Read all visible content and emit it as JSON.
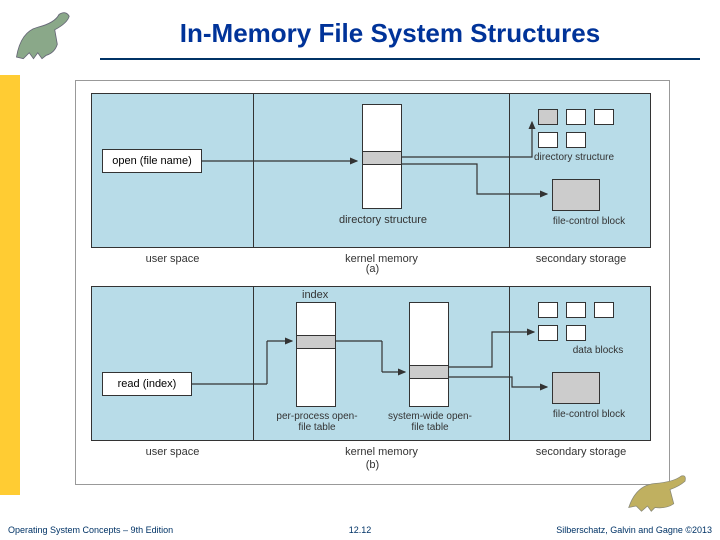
{
  "title": "In-Memory File System Structures",
  "footer": {
    "left": "Operating System Concepts – 9th Edition",
    "center": "12.12",
    "right": "Silberschatz, Galvin and Gagne ©2013"
  },
  "diagram": {
    "panelA": {
      "user_op": "open (file name)",
      "km_box": "directory structure",
      "ss_top": "directory structure",
      "ss_bottom": "file-control block",
      "sect_us": "user space",
      "sect_km": "kernel memory",
      "sect_ss": "secondary storage",
      "fig": "(a)"
    },
    "panelB": {
      "user_op": "read (index)",
      "idx_label": "index",
      "pptable": "per-process open-file table",
      "swtable": "system-wide open-file table",
      "ss_top": "data blocks",
      "ss_bottom": "file-control block",
      "sect_us": "user space",
      "sect_km": "kernel memory",
      "sect_ss": "secondary storage",
      "fig": "(b)"
    }
  }
}
